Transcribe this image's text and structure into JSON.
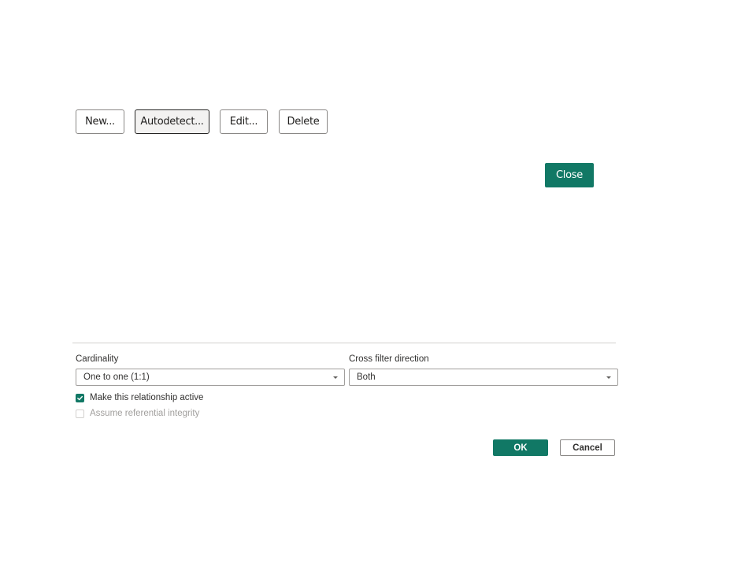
{
  "toolbar": {
    "new_label": "New...",
    "autodetect_label": "Autodetect...",
    "edit_label": "Edit...",
    "delete_label": "Delete",
    "selected": "autodetect"
  },
  "close_label": "Close",
  "form": {
    "cardinality": {
      "label": "Cardinality",
      "value": "One to one (1:1)",
      "icon": "chevron-down-icon"
    },
    "cross_filter": {
      "label": "Cross filter direction",
      "value": "Both",
      "icon": "chevron-down-icon"
    },
    "active": {
      "label": "Make this relationship active",
      "checked": true,
      "enabled": true
    },
    "integrity": {
      "label": "Assume referential integrity",
      "checked": false,
      "enabled": false
    }
  },
  "footer": {
    "ok_label": "OK",
    "cancel_label": "Cancel"
  },
  "colors": {
    "accent": "#117865",
    "border": "#8a8886",
    "disabled_text": "#a19f9d"
  }
}
